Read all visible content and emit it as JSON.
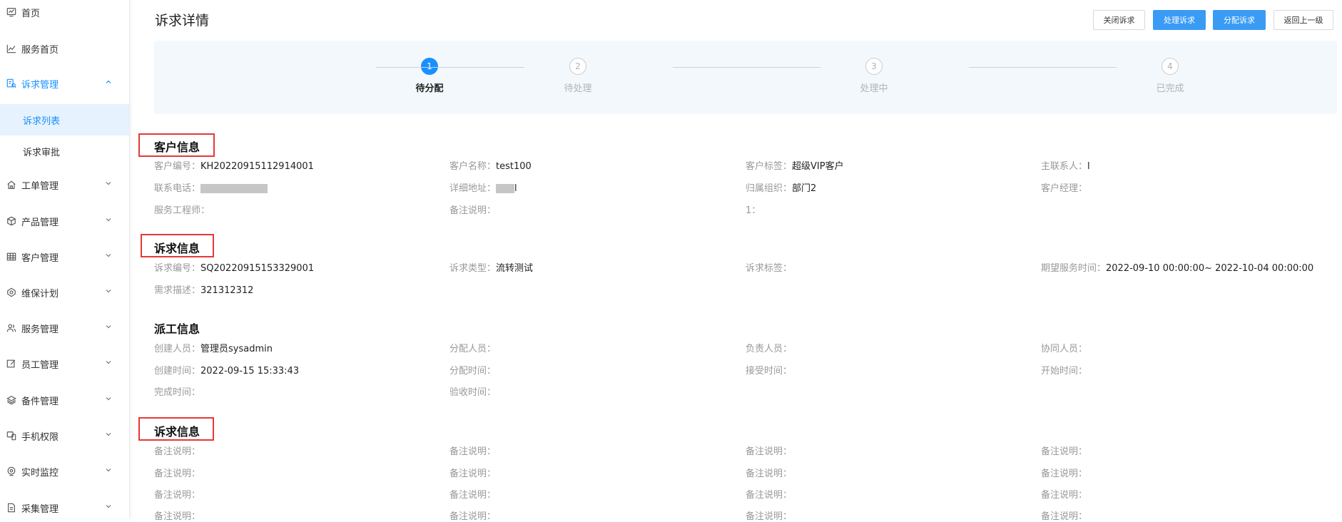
{
  "sidebar": {
    "items": [
      {
        "label": "首页",
        "icon": "dashboard-icon"
      },
      {
        "label": "服务首页",
        "icon": "line-chart-icon"
      },
      {
        "label": "诉求管理",
        "icon": "appeal-icon"
      },
      {
        "label": "工单管理",
        "icon": "home-icon"
      },
      {
        "label": "产品管理",
        "icon": "cube-icon"
      },
      {
        "label": "客户管理",
        "icon": "table-icon"
      },
      {
        "label": "维保计划",
        "icon": "maintenance-icon"
      },
      {
        "label": "服务管理",
        "icon": "users-icon"
      },
      {
        "label": "员工管理",
        "icon": "edit-icon"
      },
      {
        "label": "备件管理",
        "icon": "layers-icon"
      },
      {
        "label": "手机权限",
        "icon": "phone-icon"
      },
      {
        "label": "实时监控",
        "icon": "monitor-icon"
      },
      {
        "label": "采集管理",
        "icon": "file-icon"
      }
    ],
    "sub_items": [
      {
        "label": "诉求列表"
      },
      {
        "label": "诉求审批"
      }
    ]
  },
  "header": {
    "title": "诉求详情",
    "buttons": {
      "close": "关闭诉求",
      "handle": "处理诉求",
      "assign": "分配诉求",
      "back": "返回上一级"
    }
  },
  "steps": [
    {
      "num": "1",
      "label": "待分配"
    },
    {
      "num": "2",
      "label": "待处理"
    },
    {
      "num": "3",
      "label": "处理中"
    },
    {
      "num": "4",
      "label": "已完成"
    }
  ],
  "customer": {
    "title": "客户信息",
    "rows": [
      [
        {
          "k": "客户编号：",
          "v": "KH20220915112914001"
        },
        {
          "k": "客户名称：",
          "v": "test100"
        },
        {
          "k": "客户标签：",
          "v": "超级VIP客户"
        },
        {
          "k": "主联系人：",
          "v": "l"
        }
      ],
      [
        {
          "k": "联系电话：",
          "v": ""
        },
        {
          "k": "详细地址：",
          "v": "l"
        },
        {
          "k": "归属组织：",
          "v": "部门2"
        },
        {
          "k": "客户经理：",
          "v": ""
        }
      ],
      [
        {
          "k": "服务工程师：",
          "v": ""
        },
        {
          "k": "备注说明：",
          "v": ""
        },
        {
          "k": "1：",
          "v": ""
        }
      ]
    ]
  },
  "appeal": {
    "title": "诉求信息",
    "rows": [
      [
        {
          "k": "诉求编号：",
          "v": "SQ20220915153329001"
        },
        {
          "k": "诉求类型：",
          "v": "流转测试"
        },
        {
          "k": "诉求标签：",
          "v": ""
        },
        {
          "k": "期望服务时间：",
          "v": "2022-09-10 00:00:00~ 2022-10-04 00:00:00"
        }
      ],
      [
        {
          "k": "需求描述：",
          "v": "321312312"
        }
      ]
    ]
  },
  "dispatch": {
    "title": "派工信息",
    "rows": [
      [
        {
          "k": "创建人员：",
          "v": "管理员sysadmin"
        },
        {
          "k": "分配人员：",
          "v": ""
        },
        {
          "k": "负责人员：",
          "v": ""
        },
        {
          "k": "协同人员：",
          "v": ""
        }
      ],
      [
        {
          "k": "创建时间：",
          "v": "2022-09-15 15:33:43"
        },
        {
          "k": "分配时间：",
          "v": ""
        },
        {
          "k": "接受时间：",
          "v": ""
        },
        {
          "k": "开始时间：",
          "v": ""
        }
      ],
      [
        {
          "k": "完成时间：",
          "v": ""
        },
        {
          "k": "验收时间：",
          "v": ""
        }
      ]
    ]
  },
  "remarks": {
    "title": "诉求信息",
    "label": "备注说明：",
    "row_count": 4,
    "col_count": 4
  },
  "colors": {
    "primary": "#1890ff",
    "button_primary": "#3a9bf5",
    "highlight_box": "#e53935",
    "step_panel_bg": "#f3f8fc"
  }
}
